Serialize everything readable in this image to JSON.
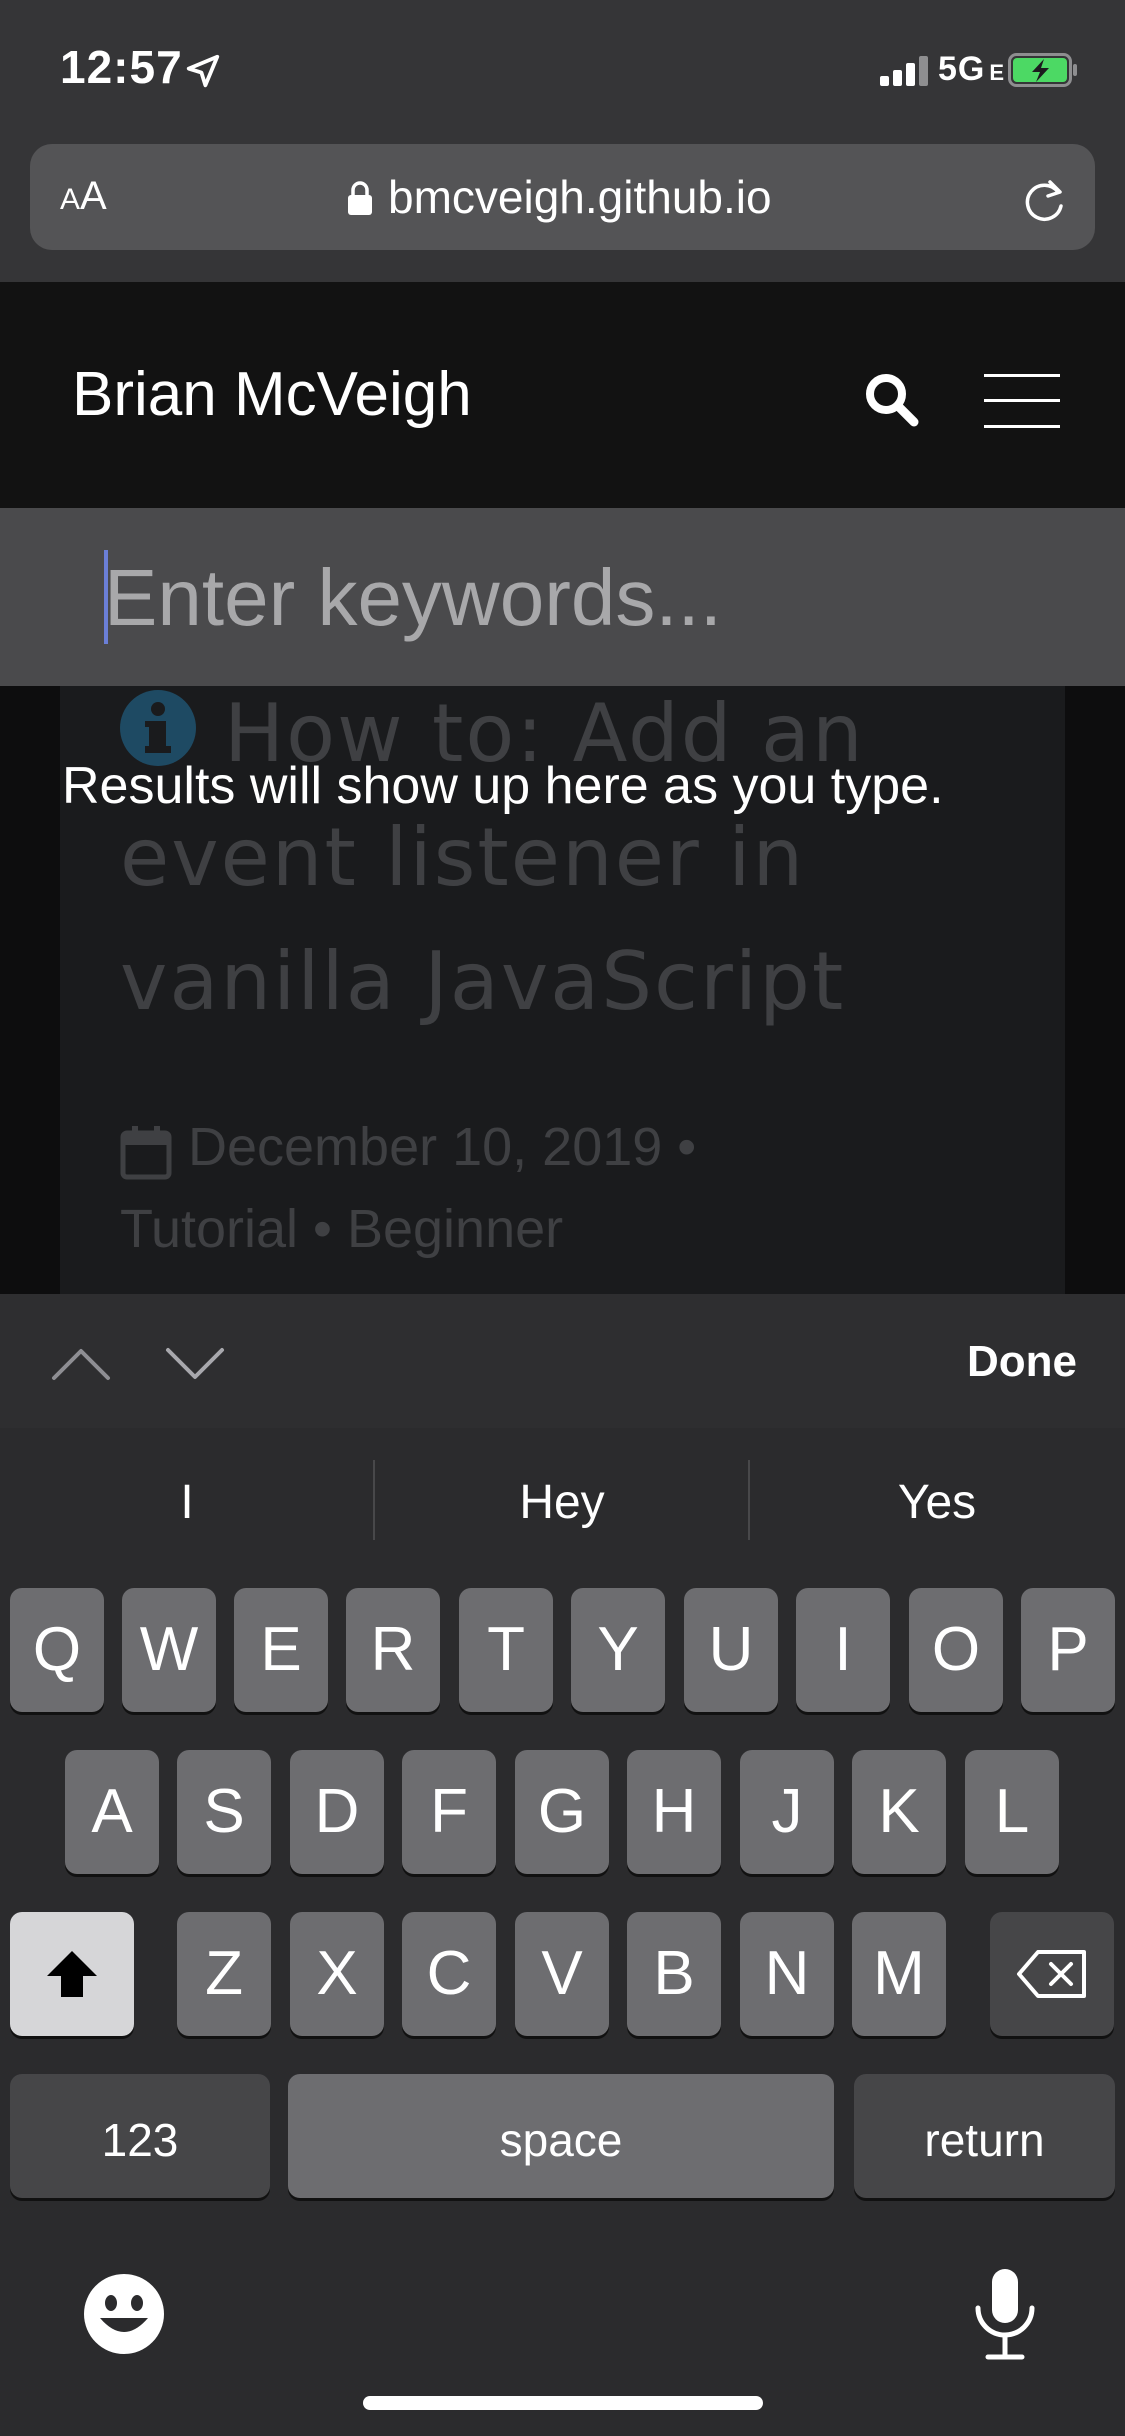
{
  "status_bar": {
    "time": "12:57",
    "network": "5G",
    "network_suffix": "E"
  },
  "browser": {
    "text_size_small": "A",
    "text_size_large": "A",
    "url": "bmcveigh.github.io"
  },
  "site": {
    "title": "Brian McVeigh"
  },
  "search": {
    "placeholder": "Enter keywords...",
    "value": "",
    "results_hint": "Results will show up here as you type."
  },
  "post": {
    "title": "How to: Add an event listener in vanilla JavaScript",
    "meta": "December 10, 2019 • Tutorial • Beginner"
  },
  "accessory_bar": {
    "done_label": "Done"
  },
  "keyboard": {
    "suggestions": [
      "I",
      "Hey",
      "Yes"
    ],
    "row1": [
      "Q",
      "W",
      "E",
      "R",
      "T",
      "Y",
      "U",
      "I",
      "O",
      "P"
    ],
    "row2": [
      "A",
      "S",
      "D",
      "F",
      "G",
      "H",
      "J",
      "K",
      "L"
    ],
    "row3": [
      "Z",
      "X",
      "C",
      "V",
      "B",
      "N",
      "M"
    ],
    "numbers_label": "123",
    "space_label": "space",
    "return_label": "return"
  },
  "colors": {
    "background": "#2c2c2e",
    "header": "#121212",
    "search_panel": "#4a4a4c",
    "key": "#6d6d70",
    "key_dark": "#464648",
    "caret": "#6b7fd7",
    "info_icon": "#1e4a63"
  },
  "icons": [
    "location-arrow-icon",
    "signal-icon",
    "battery-charging-icon",
    "lock-icon",
    "reload-icon",
    "search-icon",
    "menu-icon",
    "info-icon",
    "calendar-icon",
    "chevron-up-icon",
    "chevron-down-icon",
    "shift-icon",
    "backspace-icon",
    "emoji-icon",
    "microphone-icon"
  ]
}
